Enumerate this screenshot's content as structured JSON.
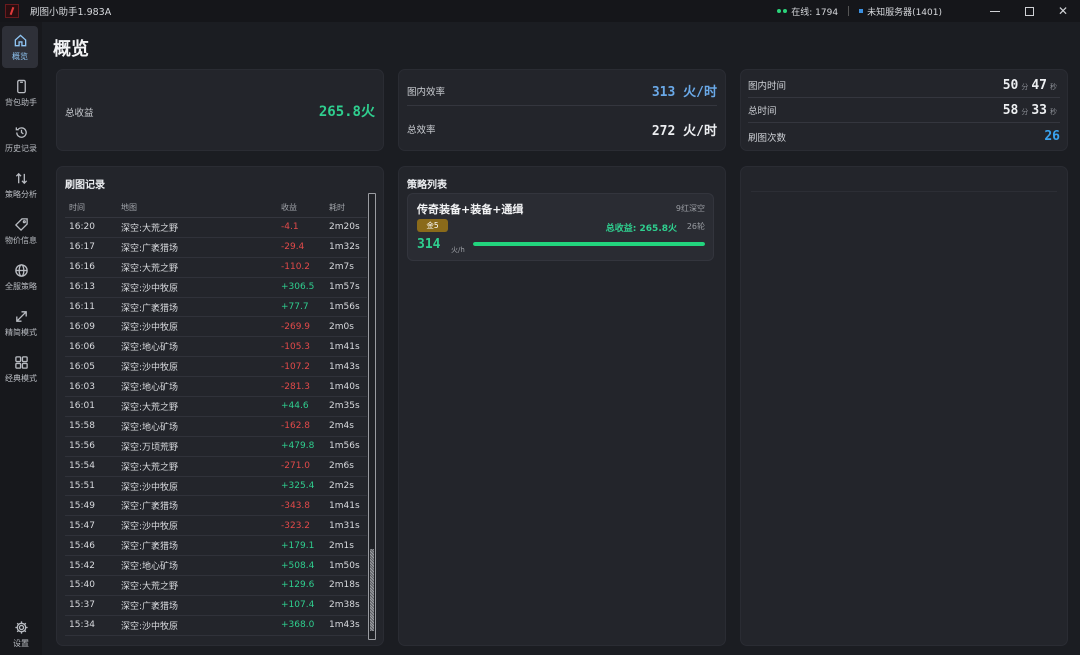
{
  "app": {
    "title": "刷图小助手1.983A"
  },
  "status": {
    "online": "在线: 1794",
    "server": "未知服务器(1401)"
  },
  "window": {
    "close": "✕"
  },
  "sidebar": {
    "items": [
      {
        "label": "概览",
        "icon": "home-icon"
      },
      {
        "label": "背包助手",
        "icon": "phone-icon"
      },
      {
        "label": "历史记录",
        "icon": "history-icon"
      },
      {
        "label": "策略分析",
        "icon": "sort-arrows-icon"
      },
      {
        "label": "物价信息",
        "icon": "tag-icon"
      },
      {
        "label": "全服策略",
        "icon": "globe-icon"
      },
      {
        "label": "精简模式",
        "icon": "expand-arrow-icon"
      },
      {
        "label": "经典模式",
        "icon": "widgets-icon"
      }
    ],
    "settings": {
      "label": "设置",
      "icon": "gear-icon"
    }
  },
  "page": {
    "title": "概览"
  },
  "summary": {
    "total_income_label": "总收益",
    "total_income_value": "265.8火",
    "map_efficiency_label": "图内效率",
    "map_efficiency_value": "313 火/时",
    "total_efficiency_label": "总效率",
    "total_efficiency_value": "272 火/时",
    "map_time_label": "图内时间",
    "map_time_min": "50",
    "map_time_sec": "47",
    "total_time_label": "总时间",
    "total_time_min": "58",
    "total_time_sec": "33",
    "unit_min": "分",
    "unit_sec": "秒",
    "runs_label": "刷图次数",
    "runs_value": "26"
  },
  "records": {
    "title": "刷图记录",
    "columns": [
      "时间",
      "地图",
      "收益",
      "耗时"
    ],
    "rows": [
      [
        "16:20",
        "深空:大荒之野",
        "-4.1",
        "2m20s"
      ],
      [
        "16:17",
        "深空:广袤猎场",
        "-29.4",
        "1m32s"
      ],
      [
        "16:16",
        "深空:大荒之野",
        "-110.2",
        "2m7s"
      ],
      [
        "16:13",
        "深空:沙中牧原",
        "+306.5",
        "1m57s"
      ],
      [
        "16:11",
        "深空:广袤猎场",
        "+77.7",
        "1m56s"
      ],
      [
        "16:09",
        "深空:沙中牧原",
        "-269.9",
        "2m0s"
      ],
      [
        "16:06",
        "深空:地心矿场",
        "-105.3",
        "1m41s"
      ],
      [
        "16:05",
        "深空:沙中牧原",
        "-107.2",
        "1m43s"
      ],
      [
        "16:03",
        "深空:地心矿场",
        "-281.3",
        "1m40s"
      ],
      [
        "16:01",
        "深空:大荒之野",
        "+44.6",
        "2m35s"
      ],
      [
        "15:58",
        "深空:地心矿场",
        "-162.8",
        "2m4s"
      ],
      [
        "15:56",
        "深空:万顷荒野",
        "+479.8",
        "1m56s"
      ],
      [
        "15:54",
        "深空:大荒之野",
        "-271.0",
        "2m6s"
      ],
      [
        "15:51",
        "深空:沙中牧原",
        "+325.4",
        "2m2s"
      ],
      [
        "15:49",
        "深空:广袤猎场",
        "-343.8",
        "1m41s"
      ],
      [
        "15:47",
        "深空:沙中牧原",
        "-323.2",
        "1m31s"
      ],
      [
        "15:46",
        "深空:广袤猎场",
        "+179.1",
        "2m1s"
      ],
      [
        "15:42",
        "深空:地心矿场",
        "+508.4",
        "1m50s"
      ],
      [
        "15:40",
        "深空:大荒之野",
        "+129.6",
        "2m18s"
      ],
      [
        "15:37",
        "深空:广袤猎场",
        "+107.4",
        "2m38s"
      ],
      [
        "15:34",
        "深空:沙中牧原",
        "+368.0",
        "1m43s"
      ]
    ]
  },
  "strategies": {
    "title": "策略列表",
    "items": [
      {
        "name": "传奇装备+装备+通缉",
        "zone": "9红深空",
        "badge": "金5",
        "total": "总收益: 265.8火",
        "rounds": "26轮",
        "rate": "314",
        "rate_unit": "火/h",
        "progress_fraction": 1.0
      }
    ]
  },
  "colors": {
    "positive": "#2fcf8f",
    "negative": "#e24a4a",
    "accent_blue": "#3aa3ef"
  }
}
